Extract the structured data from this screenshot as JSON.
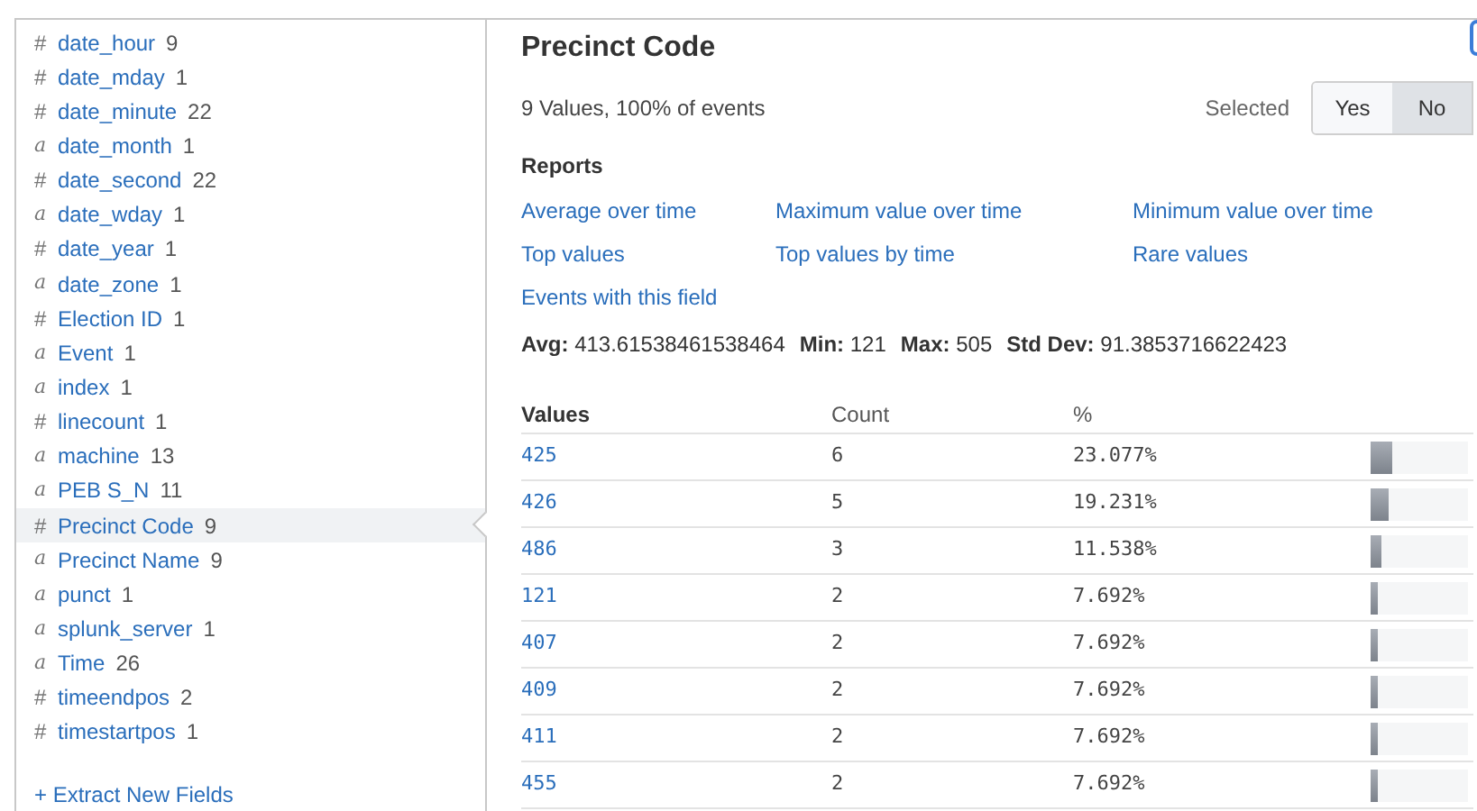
{
  "fields": [
    {
      "type_icon": "#",
      "name": "date_hour",
      "count": "9",
      "selected": false
    },
    {
      "type_icon": "#",
      "name": "date_mday",
      "count": "1",
      "selected": false
    },
    {
      "type_icon": "#",
      "name": "date_minute",
      "count": "22",
      "selected": false
    },
    {
      "type_icon": "a",
      "name": "date_month",
      "count": "1",
      "selected": false
    },
    {
      "type_icon": "#",
      "name": "date_second",
      "count": "22",
      "selected": false
    },
    {
      "type_icon": "a",
      "name": "date_wday",
      "count": "1",
      "selected": false
    },
    {
      "type_icon": "#",
      "name": "date_year",
      "count": "1",
      "selected": false
    },
    {
      "type_icon": "a",
      "name": "date_zone",
      "count": "1",
      "selected": false
    },
    {
      "type_icon": "#",
      "name": "Election ID",
      "count": "1",
      "selected": false
    },
    {
      "type_icon": "a",
      "name": "Event",
      "count": "1",
      "selected": false
    },
    {
      "type_icon": "a",
      "name": "index",
      "count": "1",
      "selected": false
    },
    {
      "type_icon": "#",
      "name": "linecount",
      "count": "1",
      "selected": false
    },
    {
      "type_icon": "a",
      "name": "machine",
      "count": "13",
      "selected": false
    },
    {
      "type_icon": "a",
      "name": "PEB S_N",
      "count": "11",
      "selected": false
    },
    {
      "type_icon": "#",
      "name": "Precinct Code",
      "count": "9",
      "selected": true
    },
    {
      "type_icon": "a",
      "name": "Precinct Name",
      "count": "9",
      "selected": false
    },
    {
      "type_icon": "a",
      "name": "punct",
      "count": "1",
      "selected": false
    },
    {
      "type_icon": "a",
      "name": "splunk_server",
      "count": "1",
      "selected": false
    },
    {
      "type_icon": "a",
      "name": "Time",
      "count": "26",
      "selected": false
    },
    {
      "type_icon": "#",
      "name": "timeendpos",
      "count": "2",
      "selected": false
    },
    {
      "type_icon": "#",
      "name": "timestartpos",
      "count": "1",
      "selected": false
    }
  ],
  "extract_link": "+ Extract New Fields",
  "detail": {
    "title": "Precinct Code",
    "summary": "9 Values, 100% of events",
    "selected_label": "Selected",
    "toggle": [
      {
        "label": "Yes",
        "selected": false
      },
      {
        "label": "No",
        "selected": true
      }
    ],
    "reports_heading": "Reports",
    "reports": [
      "Average over time",
      "Maximum value over time",
      "Minimum value over time",
      "Top values",
      "Top values by time",
      "Rare values",
      "Events with this field"
    ],
    "stats": [
      {
        "label": "Avg:",
        "value": "413.61538461538464"
      },
      {
        "label": "Min:",
        "value": "121"
      },
      {
        "label": "Max:",
        "value": "505"
      },
      {
        "label": "Std Dev:",
        "value": "91.3853716622423"
      }
    ],
    "table": {
      "columns": [
        "Values",
        "Count",
        "%"
      ],
      "rows": [
        {
          "value": "425",
          "count": "6",
          "percent": "23.077%",
          "level": 0.23077
        },
        {
          "value": "426",
          "count": "5",
          "percent": "19.231%",
          "level": 0.19231
        },
        {
          "value": "486",
          "count": "3",
          "percent": "11.538%",
          "level": 0.11538
        },
        {
          "value": "121",
          "count": "2",
          "percent": "7.692%",
          "level": 0.07692
        },
        {
          "value": "407",
          "count": "2",
          "percent": "7.692%",
          "level": 0.07692
        },
        {
          "value": "409",
          "count": "2",
          "percent": "7.692%",
          "level": 0.07692
        },
        {
          "value": "411",
          "count": "2",
          "percent": "7.692%",
          "level": 0.07692
        },
        {
          "value": "455",
          "count": "2",
          "percent": "7.692%",
          "level": 0.07692
        }
      ]
    }
  }
}
